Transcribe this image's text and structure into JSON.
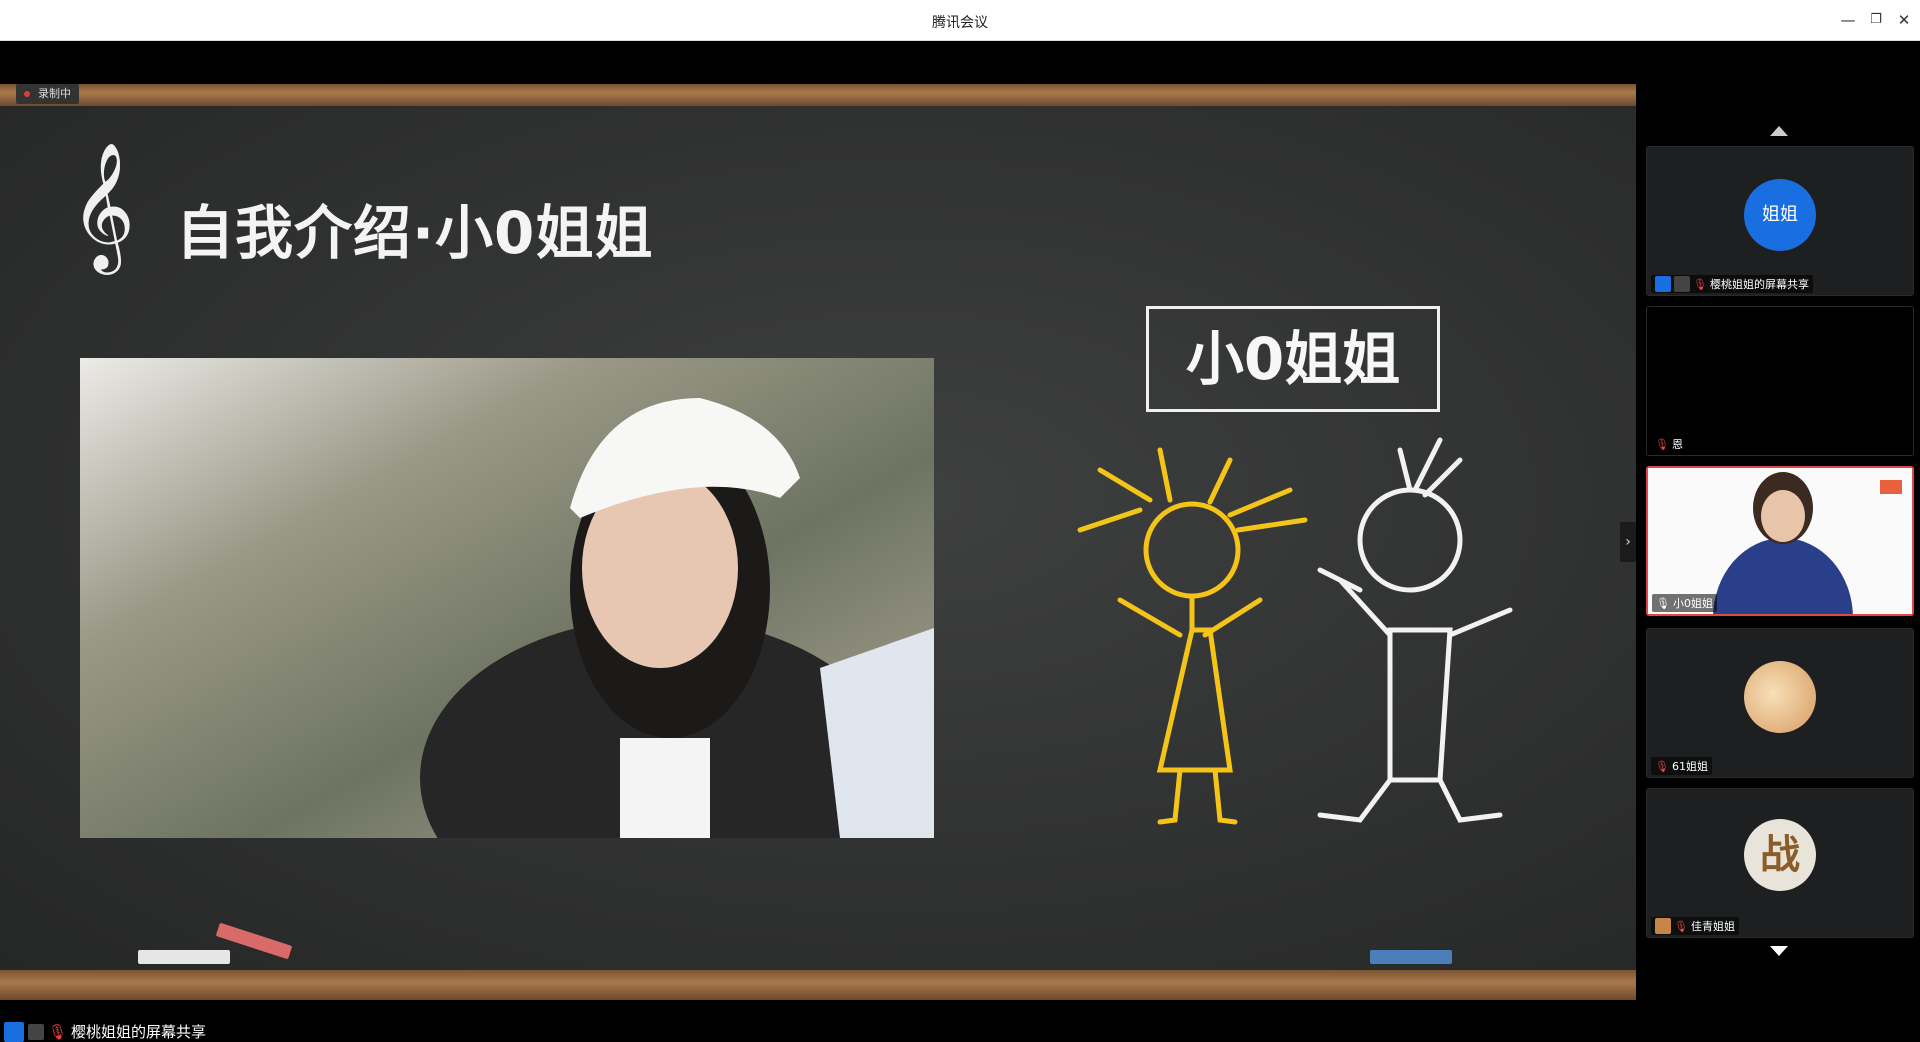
{
  "window": {
    "title": "腾讯会议"
  },
  "recording": {
    "label": "录制中"
  },
  "slide": {
    "title": "自我介绍·小0姐姐",
    "name_box": "小0姐姐"
  },
  "participants": [
    {
      "name": "樱桃姐姐的屏幕共享",
      "avatar_text": "姐姐"
    },
    {
      "name": "恩"
    },
    {
      "name": "小0姐姐"
    },
    {
      "name": "61姐姐"
    },
    {
      "name": "佳青姐姐",
      "avatar_text": "战"
    }
  ],
  "bottom": {
    "label": "樱桃姐姐的屏幕共享"
  },
  "colors": {
    "accent_blue": "#1a6fe0",
    "active_border": "#e04848",
    "chalk_yellow": "#f5c419",
    "chalk_white": "#f2f2f2"
  }
}
